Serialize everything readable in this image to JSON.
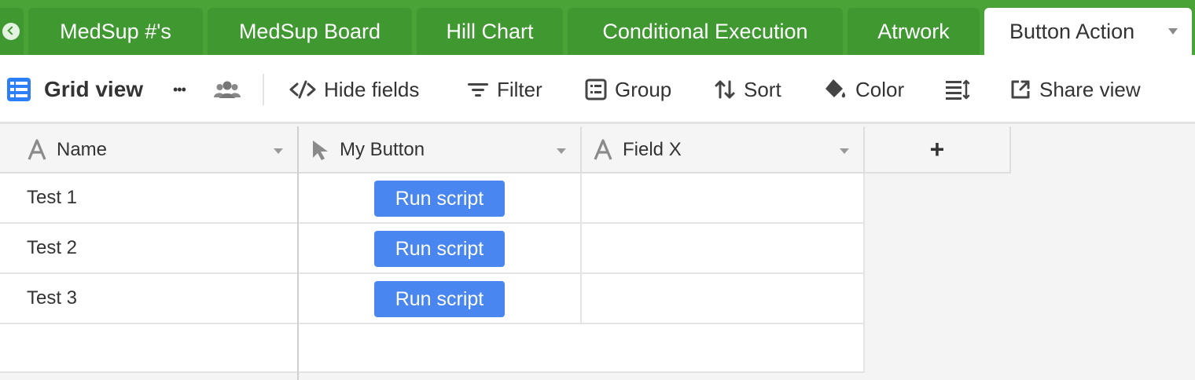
{
  "tabs": [
    {
      "label": "MedSup #'s"
    },
    {
      "label": "MedSup Board"
    },
    {
      "label": "Hill Chart"
    },
    {
      "label": "Conditional Execution"
    },
    {
      "label": "Atrwork"
    },
    {
      "label": "Button Action",
      "active": true
    }
  ],
  "toolbar": {
    "view_name": "Grid view",
    "more": "•••",
    "hide_fields": "Hide fields",
    "filter": "Filter",
    "group": "Group",
    "sort": "Sort",
    "color": "Color",
    "share_view": "Share view"
  },
  "columns": [
    {
      "label": "Name",
      "icon": "text-field-icon"
    },
    {
      "label": "My Button",
      "icon": "cursor-pointer-icon"
    },
    {
      "label": "Field X",
      "icon": "text-field-icon"
    }
  ],
  "add_field": "+",
  "rows": [
    {
      "name": "Test 1",
      "button": "Run script"
    },
    {
      "name": "Test 2",
      "button": "Run script"
    },
    {
      "name": "Test 3",
      "button": "Run script"
    }
  ],
  "colors": {
    "tabbar": "#4aa337",
    "tab": "#3f9830",
    "button": "#4a86f0",
    "view_icon": "#2d7ff9"
  }
}
